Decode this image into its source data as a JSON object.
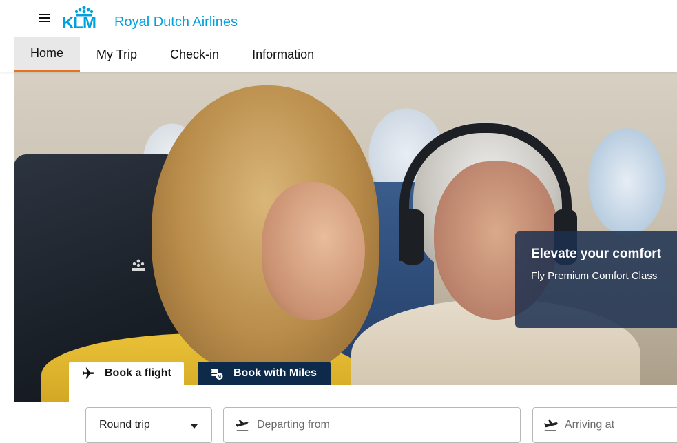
{
  "header": {
    "logo": {
      "mark": "KLM",
      "text": "Royal Dutch Airlines",
      "color": "#00a1de"
    },
    "menu_icon": "hamburger-menu-icon",
    "nav": [
      {
        "label": "Home",
        "active": true
      },
      {
        "label": "My Trip",
        "active": false
      },
      {
        "label": "Check-in",
        "active": false
      },
      {
        "label": "Information",
        "active": false
      }
    ],
    "active_tab_color": "#e37222"
  },
  "promo": {
    "title": "Elevate your comfort",
    "subtitle": "Fly Premium Comfort Class"
  },
  "booking": {
    "tabs": [
      {
        "label": "Book a flight",
        "icon": "airplane-icon",
        "active": true
      },
      {
        "label": "Book with Miles",
        "icon": "miles-coin-icon",
        "active": false
      }
    ],
    "trip_type": {
      "value": "Round trip"
    },
    "departure": {
      "placeholder": "Departing from",
      "icon": "takeoff-icon"
    },
    "arrival": {
      "placeholder": "Arriving at",
      "icon": "landing-icon"
    }
  },
  "colors": {
    "miles_tab_bg": "#0d2a4a",
    "promo_bg": "#1c3050"
  }
}
